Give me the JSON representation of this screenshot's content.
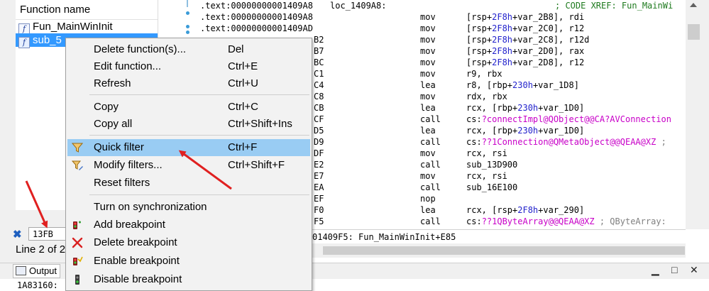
{
  "functions": {
    "header": "Function name",
    "items": [
      {
        "name": "Fun_MainWinInit",
        "selected": false
      },
      {
        "name": "sub_5",
        "selected": true
      }
    ]
  },
  "filter": {
    "value": "13FB",
    "status": "Line 2 of 2"
  },
  "disassembly": {
    "lines": [
      {
        "addr": ".text:00000000001409A8",
        "label": "loc_1409A8:",
        "mn": "",
        "op": "",
        "xref": "; CODE XREF: Fun_MainWi"
      },
      {
        "addr": ".text:00000000001409A8",
        "label": "",
        "mn": "mov",
        "op": "[rsp+2F8h+var_2B8], rdi"
      },
      {
        "addr": ".text:00000000001409AD",
        "label": "",
        "mn": "mov",
        "op": "[rsp+2F8h+var_2C0], r12"
      },
      {
        "addr": "B2",
        "label": "",
        "mn": "mov",
        "op": "[rsp+2F8h+var_2C8], r12d"
      },
      {
        "addr": "B7",
        "label": "",
        "mn": "mov",
        "op": "[rsp+2F8h+var_2D0], rax"
      },
      {
        "addr": "BC",
        "label": "",
        "mn": "mov",
        "op": "[rsp+2F8h+var_2D8], r12"
      },
      {
        "addr": "C1",
        "label": "",
        "mn": "mov",
        "op": "r9, rbx"
      },
      {
        "addr": "C4",
        "label": "",
        "mn": "lea",
        "op": "r8, [rbp+230h+var_1D8]"
      },
      {
        "addr": "C8",
        "label": "",
        "mn": "mov",
        "op": "rdx, rbx"
      },
      {
        "addr": "CB",
        "label": "",
        "mn": "lea",
        "op": "rcx, [rbp+230h+var_1D0]"
      },
      {
        "addr": "CF",
        "label": "",
        "mn": "call",
        "op": "cs:?connectImpl@QObject@@CA?AVConnection"
      },
      {
        "addr": "D5",
        "label": "",
        "mn": "lea",
        "op": "rcx, [rbp+230h+var_1D0]"
      },
      {
        "addr": "D9",
        "label": "",
        "mn": "call",
        "op": "cs:??1Connection@QMetaObject@@QEAA@XZ ;"
      },
      {
        "addr": "DF",
        "label": "",
        "mn": "mov",
        "op": "rcx, rsi"
      },
      {
        "addr": "E2",
        "label": "",
        "mn": "call",
        "op": "sub_13D900"
      },
      {
        "addr": "E7",
        "label": "",
        "mn": "mov",
        "op": "rcx, rsi"
      },
      {
        "addr": "EA",
        "label": "",
        "mn": "call",
        "op": "sub_16E100"
      },
      {
        "addr": "EF",
        "label": "",
        "mn": "nop",
        "op": ""
      },
      {
        "addr": "F0",
        "label": "",
        "mn": "lea",
        "op": "rcx, [rsp+2F8h+var_290]"
      },
      {
        "addr": "F5",
        "label": "",
        "mn": "call",
        "op": "cs:??1QByteArray@@QEAA@XZ ; QByteArray:"
      }
    ],
    "status": "01409F5: Fun_MainWinInit+E85"
  },
  "output": {
    "tab_label": "Output",
    "text": "1A83160:"
  },
  "context_menu": {
    "items": [
      {
        "label": "Delete function(s)...",
        "shortcut": "Del",
        "icon": ""
      },
      {
        "label": "Edit function...",
        "shortcut": "Ctrl+E",
        "icon": ""
      },
      {
        "label": "Refresh",
        "shortcut": "Ctrl+U",
        "icon": ""
      },
      {
        "label": "Copy",
        "shortcut": "Ctrl+C",
        "icon": ""
      },
      {
        "label": "Copy all",
        "shortcut": "Ctrl+Shift+Ins",
        "icon": ""
      },
      {
        "label": "Quick filter",
        "shortcut": "Ctrl+F",
        "icon": "funnel-icon",
        "highlighted": true
      },
      {
        "label": "Modify filters...",
        "shortcut": "Ctrl+Shift+F",
        "icon": "funnel-edit-icon"
      },
      {
        "label": "Reset filters",
        "shortcut": "",
        "icon": ""
      },
      {
        "label": "Turn on synchronization",
        "shortcut": "",
        "icon": ""
      },
      {
        "label": "Add breakpoint",
        "shortcut": "",
        "icon": "add-breakpoint-icon"
      },
      {
        "label": "Delete breakpoint",
        "shortcut": "",
        "icon": "delete-x-icon"
      },
      {
        "label": "Enable breakpoint",
        "shortcut": "",
        "icon": "enable-breakpoint-icon"
      },
      {
        "label": "Disable breakpoint",
        "shortcut": "",
        "icon": "disable-breakpoint-icon"
      }
    ]
  },
  "colors": {
    "selection": "#3399ff",
    "menu_highlight": "#99ccf3",
    "annotation_arrow": "#e02020",
    "string_pink": "#c800c8",
    "offset_blue": "#2222cc"
  }
}
